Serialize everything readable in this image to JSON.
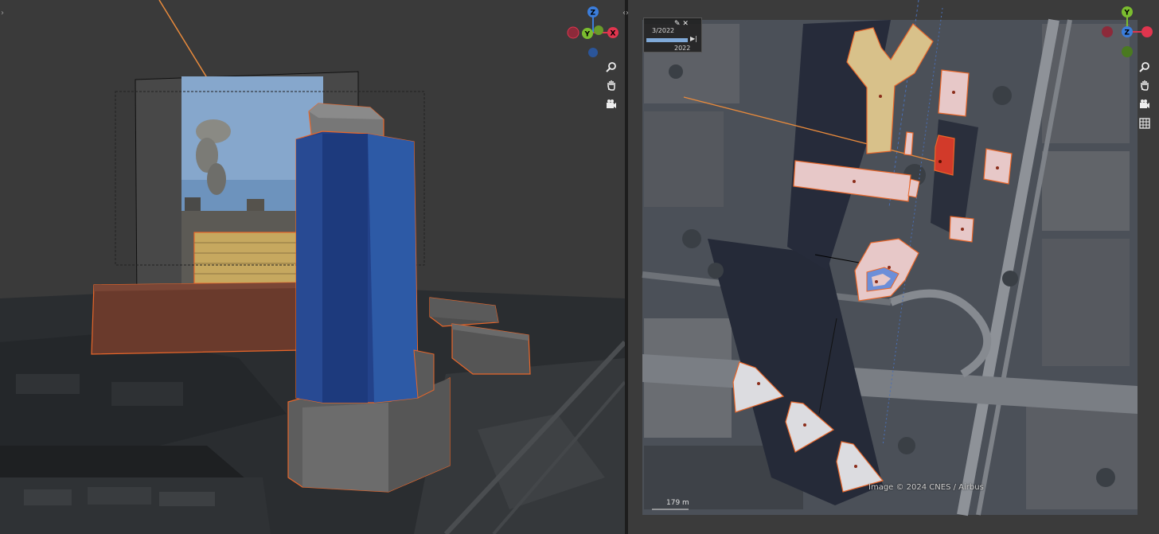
{
  "left_viewport": {
    "gizmo": {
      "x": "X",
      "y": "Y",
      "z": "Z"
    },
    "nav_icons": [
      "zoom-icon",
      "hand-pan-icon",
      "camera-icon"
    ]
  },
  "right_viewport": {
    "gizmo": {
      "x": "X",
      "y": "Y",
      "z": "Z"
    },
    "nav_icons": [
      "zoom-icon",
      "hand-pan-icon",
      "camera-icon",
      "grid-icon"
    ],
    "timeline": {
      "date": "3/2022",
      "year": "2022"
    },
    "copyright": "Image © 2024 CNES / Airbus",
    "scale": "179 m"
  },
  "colors": {
    "selection_outline": "#e8662a",
    "blue_tower": "#2a4f8f",
    "axis_x": "#e0354e",
    "axis_y": "#7bbd2f",
    "axis_z": "#3b7ddb"
  }
}
